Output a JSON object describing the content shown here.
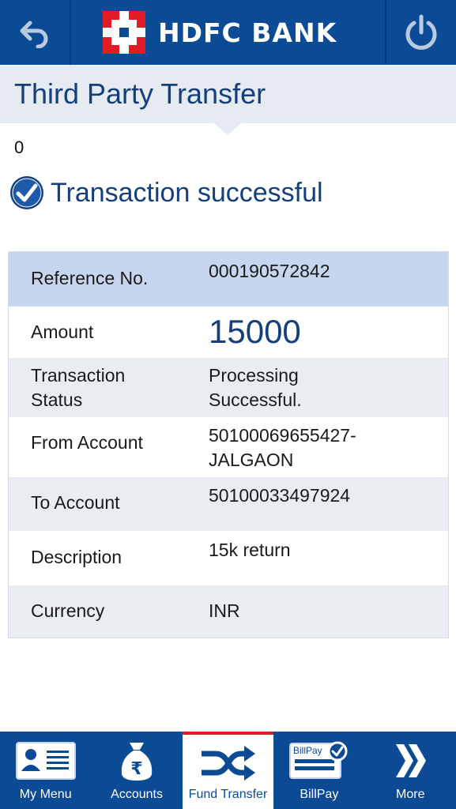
{
  "header": {
    "brand": "HDFC BANK",
    "back_icon": "back-arrow-icon",
    "power_icon": "power-icon",
    "colors": {
      "primary": "#0b4a95",
      "logo_red": "#e21b24"
    }
  },
  "page": {
    "title": "Third Party Transfer",
    "counter": "0",
    "status_message": "Transaction successful"
  },
  "details": [
    {
      "label": "Reference No.",
      "value": "000190572842"
    },
    {
      "label": "Amount",
      "value": "15000"
    },
    {
      "label": "Transaction Status",
      "label_lines": [
        "Transaction",
        "Status"
      ],
      "value_lines": [
        "Processing",
        "Successful."
      ]
    },
    {
      "label": "From Account",
      "value_lines": [
        "50100069655427-",
        "JALGAON"
      ]
    },
    {
      "label": "To Account",
      "value": "50100033497924"
    },
    {
      "label": "Description",
      "value": "15k return"
    },
    {
      "label": "Currency",
      "value": "INR"
    }
  ],
  "nav": {
    "items": [
      {
        "label": "My Menu",
        "icon": "id-card-icon",
        "active": false
      },
      {
        "label": "Accounts",
        "icon": "money-bag-icon",
        "active": false
      },
      {
        "label": "Fund Transfer",
        "icon": "shuffle-arrows-icon",
        "active": true
      },
      {
        "label": "BillPay",
        "icon": "billpay-icon",
        "icon_text": "BillPay",
        "active": false
      },
      {
        "label": "More",
        "icon": "double-chevron-icon",
        "active": false
      }
    ]
  }
}
